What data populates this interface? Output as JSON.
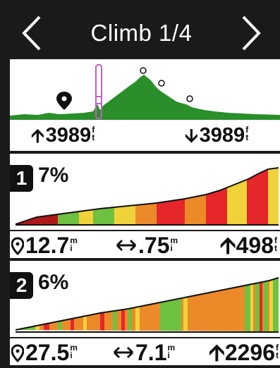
{
  "header": {
    "title": "Climb 1/4"
  },
  "overview": {
    "total_ascent": "3989",
    "total_descent": "3989",
    "elevation_unit": "ft"
  },
  "climbs": [
    {
      "number": "1",
      "grade": "7%",
      "distance_to_climb": "12.7",
      "distance_unit": "mi",
      "length": ".75",
      "length_unit": "mi",
      "ascent": "498",
      "ascent_unit": "ft"
    },
    {
      "number": "2",
      "grade": "6%",
      "distance_to_climb": "27.5",
      "distance_unit": "mi",
      "length": "7.1",
      "length_unit": "mi",
      "ascent": "2296",
      "ascent_unit": "ft"
    }
  ],
  "colors": {
    "green": "#2a8f2a",
    "light_green": "#6fc141",
    "yellow": "#f0d23a",
    "orange": "#ec8a2a",
    "red": "#e5262a",
    "dark_red": "#b01818",
    "marker": "#c060c0"
  },
  "icons": [
    "chevron-left-icon",
    "chevron-right-icon",
    "location-pin-icon",
    "up-arrow-icon",
    "down-arrow-icon",
    "horizontal-arrows-icon"
  ]
}
